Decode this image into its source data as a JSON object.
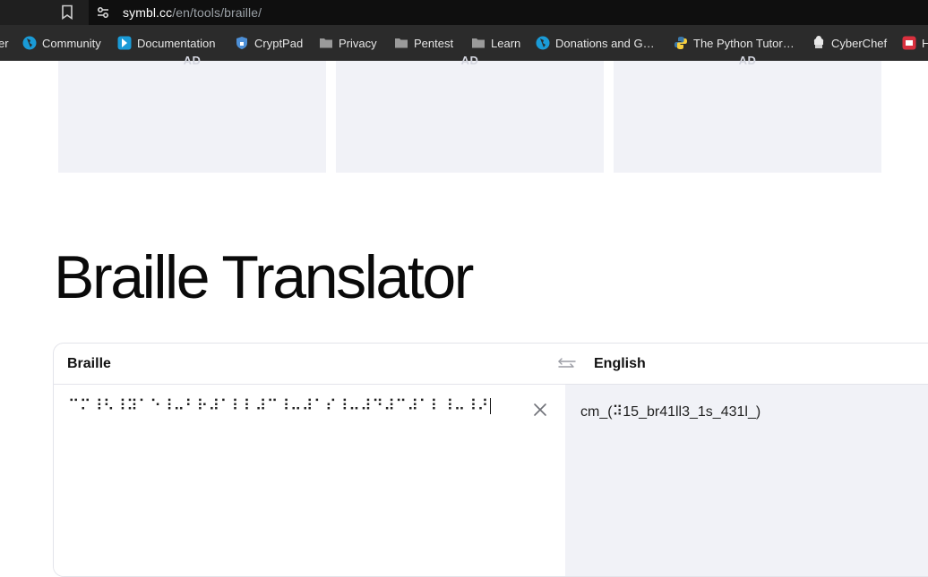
{
  "browser": {
    "url_host": "symbl.cc",
    "url_path": "/en/tools/braille/"
  },
  "bookmarks": [
    {
      "label": "er",
      "icon": "bookmark-icon"
    },
    {
      "label": "Community",
      "icon": "globe-icon"
    },
    {
      "label": "Documentation",
      "icon": "docs-icon"
    },
    {
      "label": "CryptPad",
      "icon": "shield-icon"
    },
    {
      "label": "Privacy",
      "icon": "folder-icon"
    },
    {
      "label": "Pentest",
      "icon": "folder-icon"
    },
    {
      "label": "Learn",
      "icon": "folder-icon"
    },
    {
      "label": "Donations and G…",
      "icon": "globe-icon"
    },
    {
      "label": "The Python Tutor…",
      "icon": "python-icon"
    },
    {
      "label": "CyberChef",
      "icon": "chef-icon"
    },
    {
      "label": "H",
      "icon": "red-app-icon"
    }
  ],
  "ads": [
    "AD",
    "AD",
    "AD"
  ],
  "page": {
    "title": "Braille Translator"
  },
  "translator": {
    "source_label": "Braille",
    "target_label": "English",
    "braille_value": "⠉⠍⠸⠣⠸⠽⠁⠑⠸⠤⠃⠗⠼⠁⠇⠇⠼⠉⠸⠤⠼⠁⠎⠸⠤⠼⠙⠼⠉⠼⠁⠇⠸⠤⠸⠜",
    "english_value": "cm_(⠽15_br41ll3_1s_431l_)"
  },
  "colors": {
    "chrome_dark": "#1f1f1f",
    "bookmarks_bar": "#2b2b2b",
    "ad_background": "#f1f2f7",
    "output_background": "#f1f2f7"
  }
}
